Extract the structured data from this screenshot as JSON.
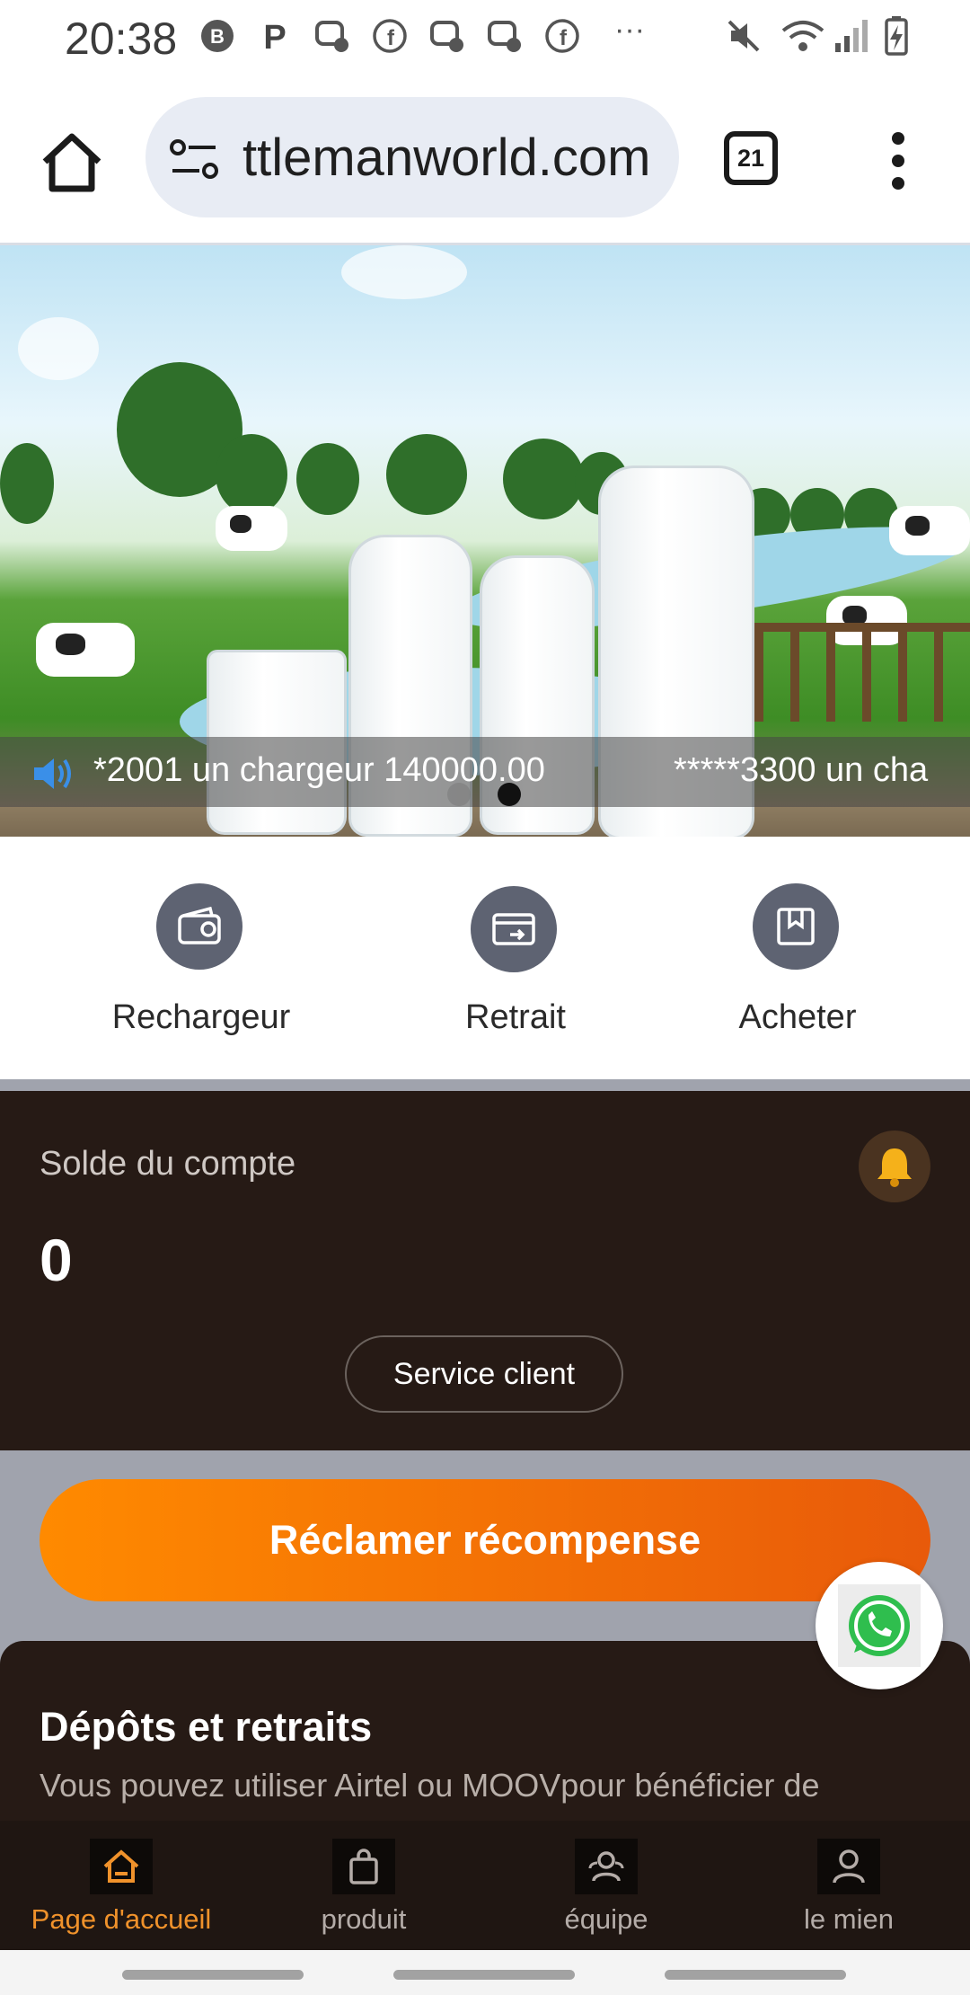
{
  "status_bar": {
    "time": "20:38",
    "icons": [
      "b-badge-icon",
      "p-icon",
      "messenger-icon",
      "facebook-icon",
      "messenger-icon",
      "messenger-icon",
      "facebook-icon",
      "more-icon",
      "mute-icon",
      "wifi-icon",
      "signal-icon",
      "battery-charging-icon"
    ],
    "more": "···"
  },
  "browser": {
    "url": "ttlemanworld.com",
    "tab_count": "21"
  },
  "banner": {
    "ticker_1": "*2001 un chargeur 140000.00",
    "ticker_2": "*****3300 un cha",
    "active_dot": 1
  },
  "actions": [
    {
      "label": "Rechargeur",
      "icon": "wallet-icon"
    },
    {
      "label": "Retrait",
      "icon": "withdraw-card-icon"
    },
    {
      "label": "Acheter",
      "icon": "bookmark-box-icon"
    }
  ],
  "balance": {
    "label": "Solde du compte",
    "amount": "0",
    "service_button": "Service client"
  },
  "reward_button": "Réclamer récompense",
  "info": {
    "title": "Dépôts et retraits",
    "description": "Vous pouvez utiliser Airtel ou MOOVpour bénéficier de"
  },
  "bottom_nav": [
    {
      "label": "Page d'accueil",
      "icon": "home-icon",
      "active": true
    },
    {
      "label": "produit",
      "icon": "bag-icon",
      "active": false
    },
    {
      "label": "équipe",
      "icon": "team-icon",
      "active": false
    },
    {
      "label": "le mien",
      "icon": "user-icon",
      "active": false
    }
  ],
  "colors": {
    "accent": "#ff8a00",
    "dark_card": "#261a15",
    "nav_active": "#f0922b"
  }
}
